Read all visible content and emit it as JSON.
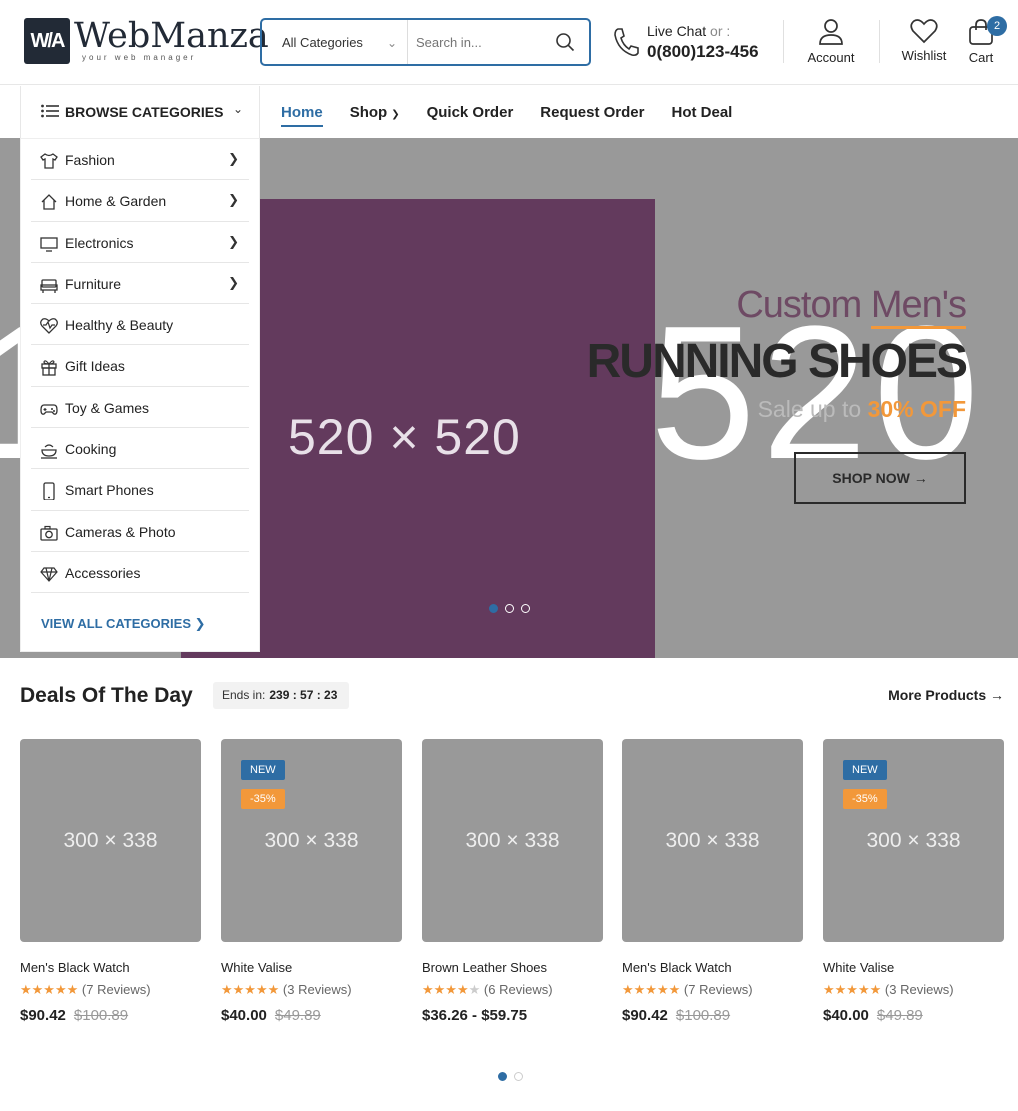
{
  "brand": {
    "logo_mark": "W/A",
    "logo_word": "WebManza",
    "logo_tagline": "your web manager"
  },
  "search": {
    "category": "All Categories",
    "placeholder": "Search in..."
  },
  "contact": {
    "label": "Live Chat",
    "or": "or :",
    "phone": "0(800)123-456"
  },
  "header_actions": {
    "account": "Account",
    "wishlist": "Wishlist",
    "cart": "Cart",
    "cart_count": "2"
  },
  "nav": {
    "browse_label": "BROWSE CATEGORIES",
    "items": [
      "Home",
      "Shop",
      "Quick Order",
      "Request Order",
      "Hot Deal"
    ]
  },
  "categories": [
    {
      "label": "Fashion",
      "icon": "shirt-icon",
      "has_sub": true
    },
    {
      "label": "Home & Garden",
      "icon": "home-icon",
      "has_sub": true
    },
    {
      "label": "Electronics",
      "icon": "monitor-icon",
      "has_sub": true
    },
    {
      "label": "Furniture",
      "icon": "sofa-icon",
      "has_sub": true
    },
    {
      "label": "Healthy & Beauty",
      "icon": "heart-pulse-icon",
      "has_sub": false
    },
    {
      "label": "Gift Ideas",
      "icon": "gift-icon",
      "has_sub": false
    },
    {
      "label": "Toy & Games",
      "icon": "gamepad-icon",
      "has_sub": false
    },
    {
      "label": "Cooking",
      "icon": "cooking-pot-icon",
      "has_sub": false
    },
    {
      "label": "Smart Phones",
      "icon": "smartphone-icon",
      "has_sub": false
    },
    {
      "label": "Cameras & Photo",
      "icon": "camera-icon",
      "has_sub": false
    },
    {
      "label": "Accessories",
      "icon": "diamond-icon",
      "has_sub": false
    }
  ],
  "view_all": "VIEW ALL CATEGORIES",
  "hero": {
    "placeholder": "520 × 520",
    "bg_text": "520",
    "bg_text_left": "1",
    "subtitle_a": "Custom",
    "subtitle_b": "Men's",
    "headline": "RUNNING SHOES",
    "sale_prefix": "Sale up to",
    "sale_value": "30% OFF",
    "cta": "SHOP NOW",
    "slide_count": 3,
    "active_slide": 1
  },
  "deals": {
    "title": "Deals Of The Day",
    "ends_label": "Ends in:",
    "countdown": "239 : 57 : 23",
    "more": "More Products",
    "products": [
      {
        "img": "300 × 338",
        "badge_new": "",
        "badge_discount": "",
        "name": "Men's Black Watch",
        "stars": 5,
        "reviews": "(7 Reviews)",
        "price": "$90.42",
        "old_price": "$100.89"
      },
      {
        "img": "300 × 338",
        "badge_new": "NEW",
        "badge_discount": "-35%",
        "name": "White Valise",
        "stars": 5,
        "reviews": "(3 Reviews)",
        "price": "$40.00",
        "old_price": "$49.89"
      },
      {
        "img": "300 × 338",
        "badge_new": "",
        "badge_discount": "",
        "name": "Brown Leather Shoes",
        "stars": 4,
        "reviews": "(6 Reviews)",
        "price": "$36.26 - $59.75",
        "old_price": ""
      },
      {
        "img": "300 × 338",
        "badge_new": "",
        "badge_discount": "",
        "name": "Men's Black Watch",
        "stars": 5,
        "reviews": "(7 Reviews)",
        "price": "$90.42",
        "old_price": "$100.89"
      },
      {
        "img": "300 × 338",
        "badge_new": "NEW",
        "badge_discount": "-35%",
        "name": "White Valise",
        "stars": 5,
        "reviews": "(3 Reviews)",
        "price": "$40.00",
        "old_price": "$49.89"
      }
    ],
    "page_count": 2,
    "active_page": 1
  },
  "colors": {
    "accent": "#2e6da4",
    "orange": "#f2983a",
    "hero_bg": "#999999",
    "hero_purple": "#633a5d"
  }
}
